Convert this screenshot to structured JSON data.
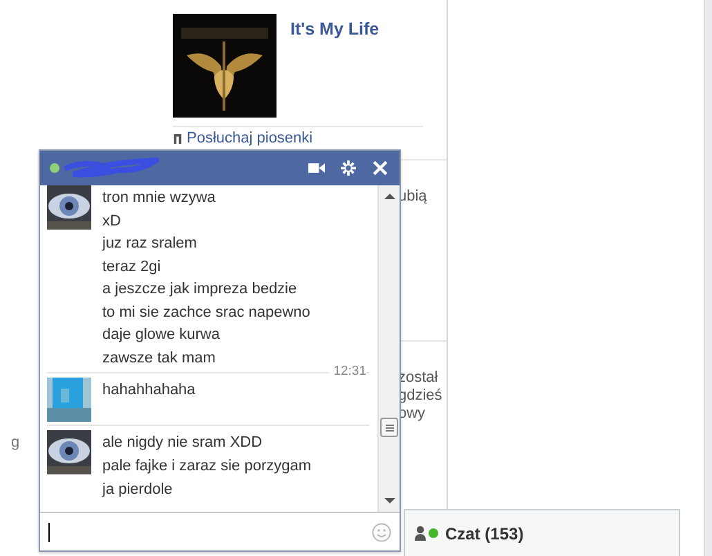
{
  "post": {
    "title": "It's My Life",
    "link": "Posłuchaj piosenki"
  },
  "side_fragments": [
    {
      "lines": [
        "ubią"
      ]
    },
    {
      "lines": [
        "został",
        "gdzieś",
        "owy"
      ]
    }
  ],
  "left_fragment": "g",
  "chat": {
    "online": true,
    "groups": [
      {
        "lines": [
          "tron mnie wzywa",
          "xD",
          "juz raz sralem",
          "teraz 2gi",
          "a jeszcze jak impreza bedzie",
          "to mi sie zachce srac napewno",
          "daje glowe kurwa",
          "zawsze tak mam"
        ]
      },
      {
        "timestamp": "12:31",
        "lines": [
          "hahahhahaha"
        ]
      },
      {
        "lines": [
          "ale nigdy nie sram XDD",
          "pale fajke i zaraz sie porzygam",
          "ja pierdole"
        ]
      }
    ]
  },
  "chat_bar": {
    "label": "Czat (153)",
    "online": true
  }
}
